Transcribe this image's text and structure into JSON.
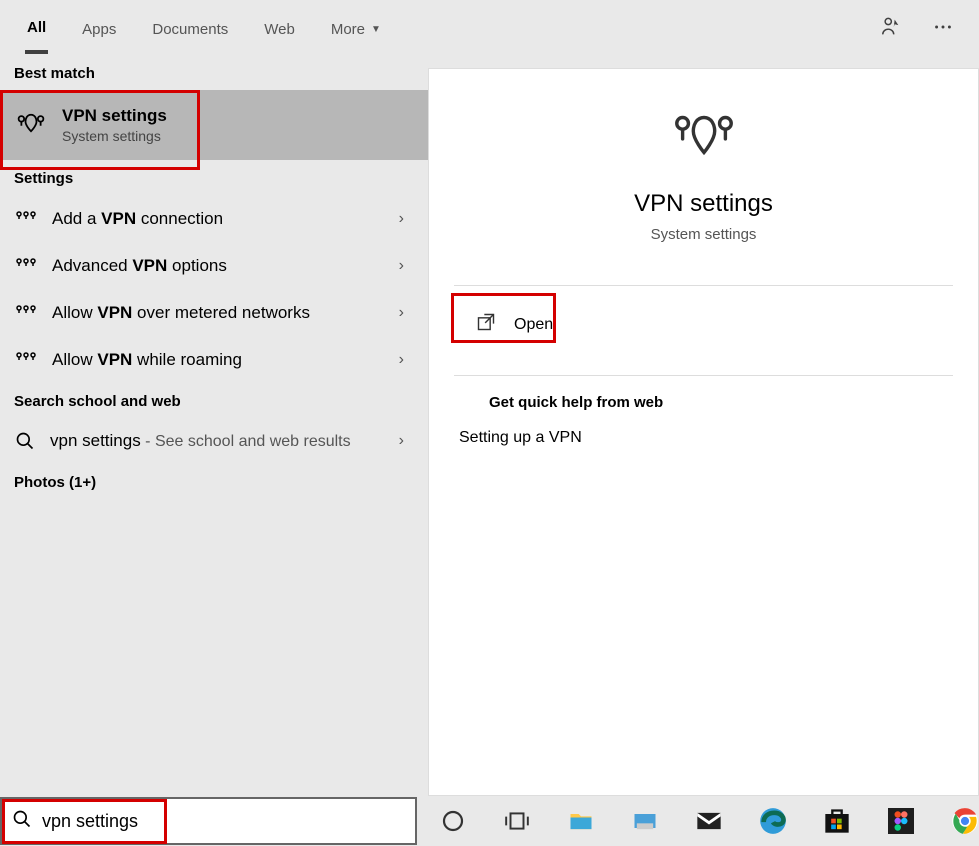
{
  "tabs": {
    "all": "All",
    "apps": "Apps",
    "documents": "Documents",
    "web": "Web",
    "more": "More"
  },
  "sections": {
    "best_match": "Best match",
    "settings": "Settings",
    "search_web": "Search school and web",
    "photos": "Photos (1+)"
  },
  "best_match": {
    "title": "VPN settings",
    "subtitle": "System settings"
  },
  "settings_items": [
    {
      "prefix": "Add a ",
      "bold": "VPN",
      "suffix": " connection"
    },
    {
      "prefix": "Advanced ",
      "bold": "VPN",
      "suffix": " options"
    },
    {
      "prefix": "Allow ",
      "bold": "VPN",
      "suffix": " over metered networks"
    },
    {
      "prefix": "Allow ",
      "bold": "VPN",
      "suffix": " while roaming"
    }
  ],
  "web_search": {
    "query": "vpn settings",
    "suffix": " - See school and web results"
  },
  "preview": {
    "title": "VPN settings",
    "subtitle": "System settings",
    "open": "Open",
    "quick_help_header": "Get quick help from web",
    "quick_link_1": "Setting up a VPN"
  },
  "search_value": "vpn settings"
}
